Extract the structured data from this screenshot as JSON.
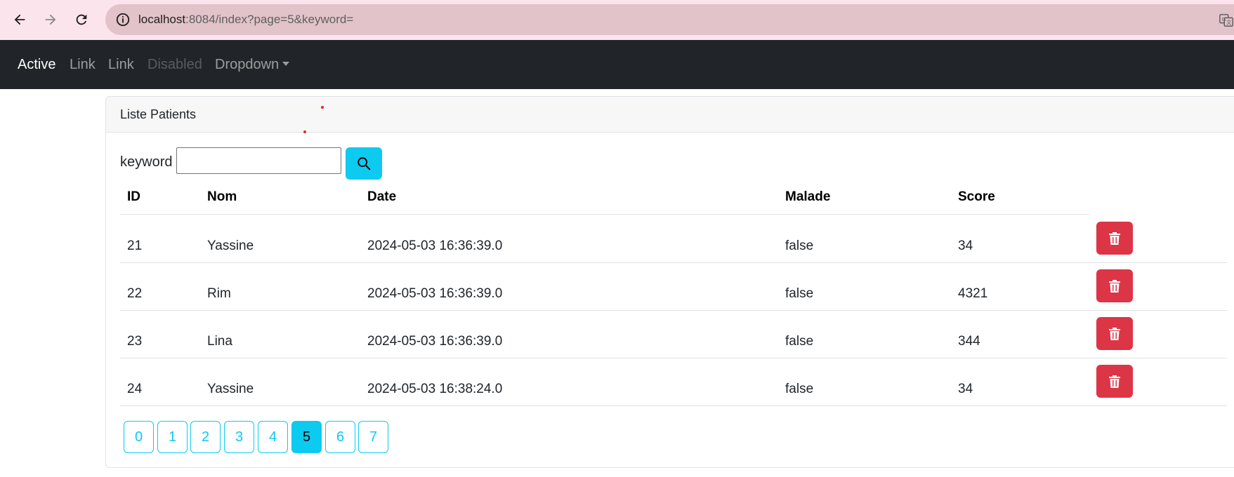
{
  "browser": {
    "url_host": "localhost",
    "url_path": ":8084/index?page=5&keyword="
  },
  "navbar": {
    "items": [
      {
        "label": "Active",
        "state": "active"
      },
      {
        "label": "Link",
        "state": "normal"
      },
      {
        "label": "Link",
        "state": "normal"
      },
      {
        "label": "Disabled",
        "state": "disabled"
      },
      {
        "label": "Dropdown",
        "state": "dropdown"
      }
    ]
  },
  "card": {
    "title": "Liste Patients"
  },
  "search": {
    "label": "keyword",
    "value": "",
    "icon": "search-icon"
  },
  "table": {
    "headers": [
      "ID",
      "Nom",
      "Date",
      "Malade",
      "Score"
    ],
    "rows": [
      {
        "id": "21",
        "nom": "Yassine",
        "date": "2024-05-03 16:36:39.0",
        "malade": "false",
        "score": "34"
      },
      {
        "id": "22",
        "nom": "Rim",
        "date": "2024-05-03 16:36:39.0",
        "malade": "false",
        "score": "4321"
      },
      {
        "id": "23",
        "nom": "Lina",
        "date": "2024-05-03 16:36:39.0",
        "malade": "false",
        "score": "344"
      },
      {
        "id": "24",
        "nom": "Yassine",
        "date": "2024-05-03 16:38:24.0",
        "malade": "false",
        "score": "34"
      }
    ],
    "delete_icon": "trash-icon"
  },
  "pagination": {
    "pages": [
      "0",
      "1",
      "2",
      "3",
      "4",
      "5",
      "6",
      "7"
    ],
    "current": "5"
  },
  "colors": {
    "browser_bar": "#fce4ec",
    "navbar": "#212529",
    "info": "#0dcaf0",
    "danger": "#dc3545"
  }
}
